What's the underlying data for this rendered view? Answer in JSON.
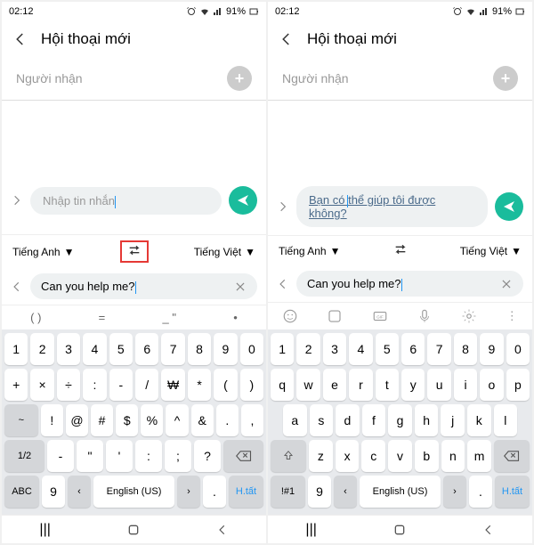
{
  "status": {
    "time": "02:12",
    "battery": "91%"
  },
  "header": {
    "title": "Hội thoại mới"
  },
  "recipient": {
    "label": "Người nhận"
  },
  "left": {
    "msg_placeholder": "Nhập tin nhắn",
    "lang_from": "Tiếng Anh",
    "lang_to": "Tiếng Việt",
    "trans_input": "Can you help me?",
    "suggest": {
      "paren": "( )",
      "eq": "=",
      "dash": "_ \"",
      "bullet": "•"
    },
    "kb_r1": [
      "1",
      "2",
      "3",
      "4",
      "5",
      "6",
      "7",
      "8",
      "9",
      "0"
    ],
    "kb_r2": [
      "+",
      "×",
      "÷",
      ":",
      "-",
      "/",
      "₩",
      "*",
      "(",
      ")"
    ],
    "kb_r3": [
      "!",
      "@",
      "#",
      "$",
      "%",
      "^",
      "&",
      ".",
      ","
    ],
    "kb_r3_pre": "~",
    "kb_r4": [
      "-",
      "\"",
      "'",
      ":",
      ";",
      "?"
    ],
    "kb_r4_pre": "1/2",
    "kb_r5_abc": "ABC",
    "kb_r5_dot": "9",
    "space": "English (US)",
    "kb_r5_period": ".",
    "kb_r5_done": "H.tất"
  },
  "right": {
    "msg_translated": "Bạn có thể giúp tôi được không?",
    "lang_from": "Tiếng Anh",
    "lang_to": "Tiếng Việt",
    "trans_input": "Can you help me?",
    "kb_r1": [
      "1",
      "2",
      "3",
      "4",
      "5",
      "6",
      "7",
      "8",
      "9",
      "0"
    ],
    "kb_r2": [
      "q",
      "w",
      "e",
      "r",
      "t",
      "y",
      "u",
      "i",
      "o",
      "p"
    ],
    "kb_r3": [
      "a",
      "s",
      "d",
      "f",
      "g",
      "h",
      "j",
      "k",
      "l"
    ],
    "kb_r4": [
      "z",
      "x",
      "c",
      "v",
      "b",
      "n",
      "m"
    ],
    "kb_r5_sym": "!#1",
    "kb_r5_dot": "9",
    "space": "English (US)",
    "kb_r5_period": ".",
    "kb_r5_done": "H.tất"
  }
}
